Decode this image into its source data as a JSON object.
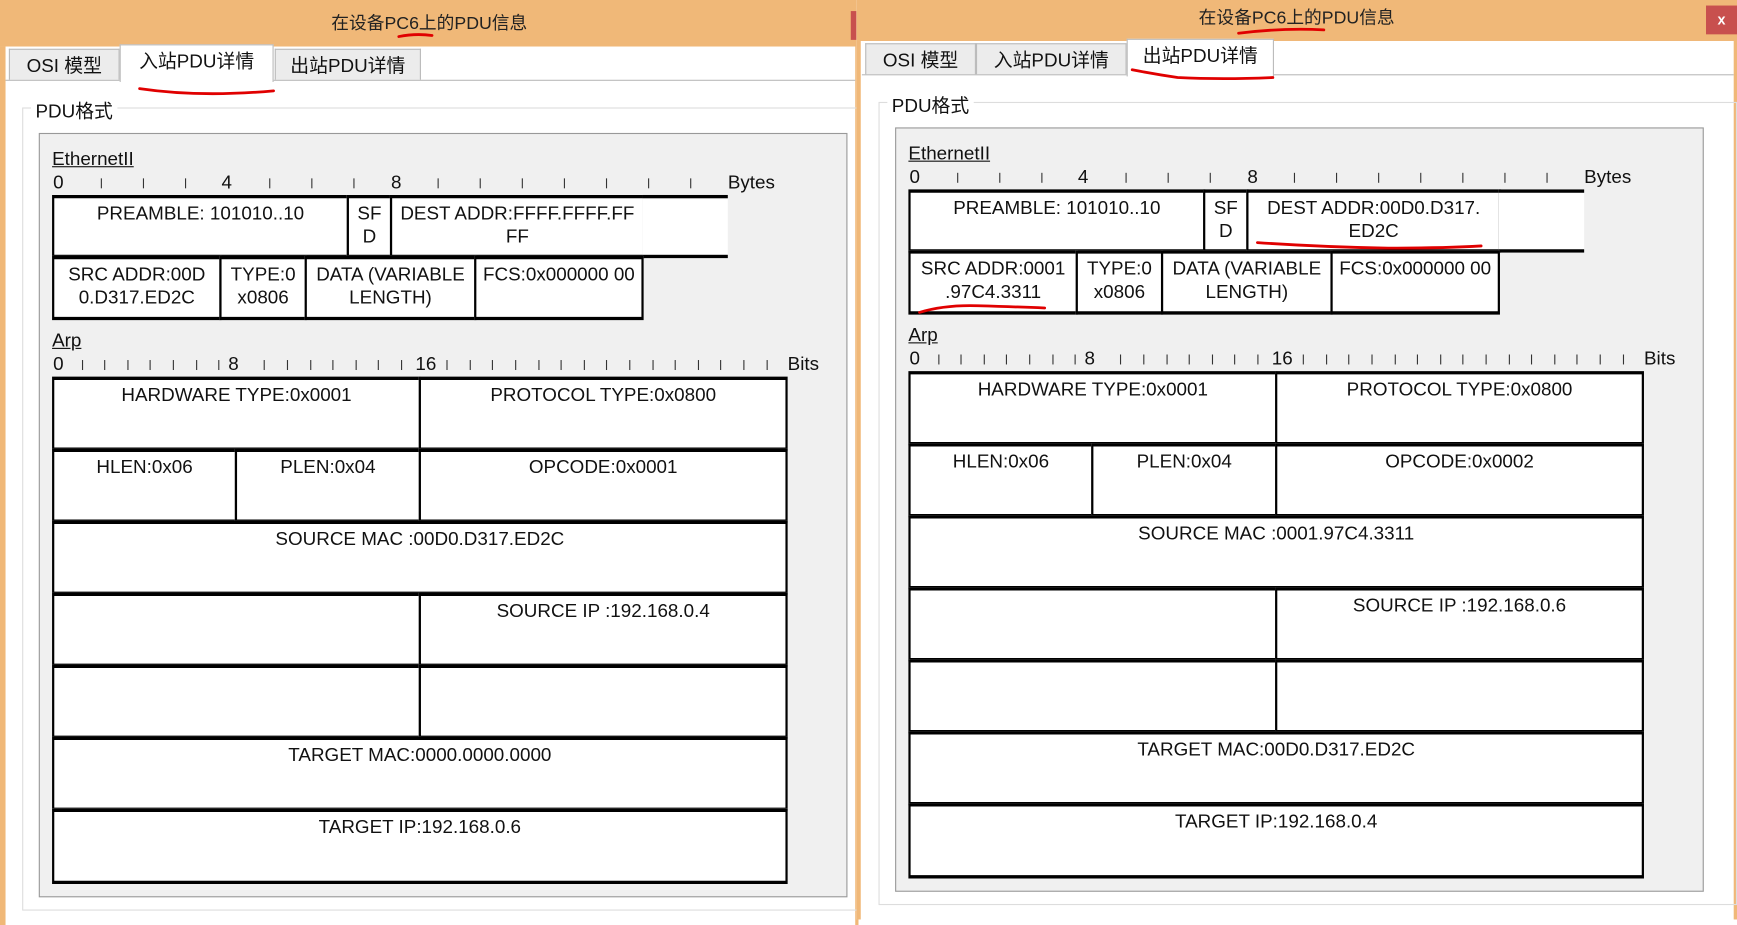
{
  "colors": {
    "titlebar": "#F0B878",
    "annotation": "#E00000",
    "close": "#C8504E"
  },
  "windows": [
    {
      "title": "在设备PC6上的PDU信息",
      "tabs": [
        "OSI 模型",
        "入站PDU详情",
        "出站PDU详情"
      ],
      "active_tab": 1,
      "group_label": "PDU格式",
      "ethernet": {
        "label": "EthernetII",
        "unit": "Bytes",
        "ticks": [
          "0",
          "4",
          "8"
        ],
        "preamble": "PREAMBLE: 101010..10",
        "sfd": "SF D",
        "dest": "DEST ADDR:FFFF.FFFF.FF FF",
        "src": "SRC ADDR:00D 0.D317.ED2C",
        "type": "TYPE:0 x0806",
        "data": "DATA (VARIABLE LENGTH)",
        "fcs": "FCS:0x000000 00"
      },
      "arp": {
        "label": "Arp",
        "unit": "Bits",
        "ticks": [
          "0",
          "8",
          "16"
        ],
        "hardware_type": "HARDWARE TYPE:0x0001",
        "protocol_type": "PROTOCOL TYPE:0x0800",
        "hlen": "HLEN:0x06",
        "plen": "PLEN:0x04",
        "opcode": "OPCODE:0x0001",
        "source_mac": "SOURCE MAC :00D0.D317.ED2C",
        "source_ip": "SOURCE IP :192.168.0.4",
        "target_mac": "TARGET MAC:0000.0000.0000",
        "target_ip": "TARGET IP:192.168.0.6"
      }
    },
    {
      "title": "在设备PC6上的PDU信息",
      "close_label": "x",
      "tabs": [
        "OSI 模型",
        "入站PDU详情",
        "出站PDU详情"
      ],
      "active_tab": 2,
      "group_label": "PDU格式",
      "ethernet": {
        "label": "EthernetII",
        "unit": "Bytes",
        "ticks": [
          "0",
          "4",
          "8"
        ],
        "preamble": "PREAMBLE: 101010..10",
        "sfd": "SF D",
        "dest": "DEST ADDR:00D0.D317. ED2C",
        "src": "SRC ADDR:0001 .97C4.3311",
        "type": "TYPE:0 x0806",
        "data": "DATA (VARIABLE LENGTH)",
        "fcs": "FCS:0x000000 00"
      },
      "arp": {
        "label": "Arp",
        "unit": "Bits",
        "ticks": [
          "0",
          "8",
          "16"
        ],
        "hardware_type": "HARDWARE TYPE:0x0001",
        "protocol_type": "PROTOCOL TYPE:0x0800",
        "hlen": "HLEN:0x06",
        "plen": "PLEN:0x04",
        "opcode": "OPCODE:0x0002",
        "source_mac": "SOURCE MAC :0001.97C4.3311",
        "source_ip": "SOURCE IP :192.168.0.6",
        "target_mac": "TARGET MAC:00D0.D317.ED2C",
        "target_ip": "TARGET IP:192.168.0.4"
      }
    }
  ]
}
